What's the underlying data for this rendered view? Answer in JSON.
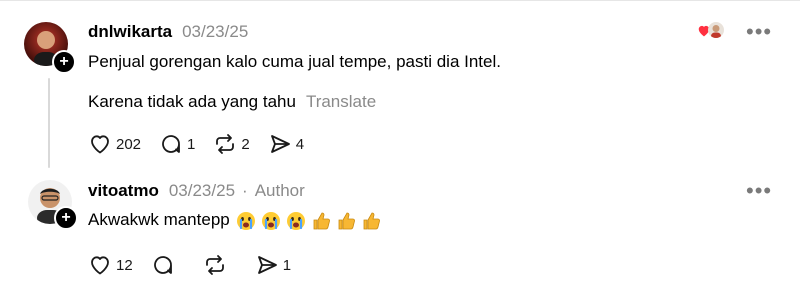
{
  "posts": [
    {
      "username": "dnlwikarta",
      "timestamp": "03/23/25",
      "lines": [
        "Penjual gorengan kalo cuma jual tempe, pasti dia Intel.",
        "Karena tidak ada yang tahu"
      ],
      "translate_label": "Translate",
      "actions": {
        "like_count": "202",
        "reply_count": "1",
        "repost_count": "2",
        "share_count": "4"
      },
      "more_label": "•••"
    },
    {
      "username": "vitoatmo",
      "timestamp": "03/23/25",
      "separator": "·",
      "author_tag": "Author",
      "text": "Akwakwk mantepp",
      "emojis": [
        "crying-face",
        "crying-face",
        "crying-face",
        "thumbs-up",
        "thumbs-up",
        "thumbs-up"
      ],
      "actions": {
        "like_count": "12",
        "share_count": "1"
      },
      "more_label": "•••"
    }
  ],
  "colors": {
    "muted_text": "#8a8a8a",
    "heart_red": "#ff3040",
    "thread_line": "#d9d9d9"
  }
}
